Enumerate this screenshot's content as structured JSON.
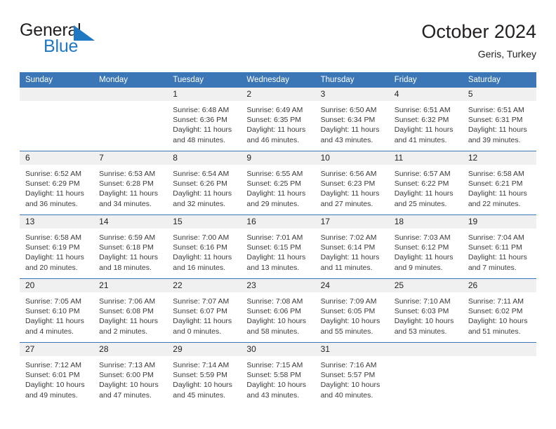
{
  "brand": {
    "name_part1": "General",
    "name_part2": "Blue",
    "triangle_color": "#1f78c1",
    "icon": "triangle-icon"
  },
  "header": {
    "title": "October 2024",
    "subtitle": "Geris, Turkey"
  },
  "colors": {
    "header_blue": "#3b77b7",
    "band_gray": "#f0f0f0",
    "text": "#231f20",
    "detail_text": "#3a3a3a",
    "brand_blue": "#1f78c1"
  },
  "weekdays": [
    "Sunday",
    "Monday",
    "Tuesday",
    "Wednesday",
    "Thursday",
    "Friday",
    "Saturday"
  ],
  "labels": {
    "sunrise": "Sunrise:",
    "sunset": "Sunset:",
    "daylight": "Daylight:"
  },
  "weeks": [
    [
      {
        "day": "",
        "empty": true
      },
      {
        "day": "",
        "empty": true
      },
      {
        "day": "1",
        "sunrise": "Sunrise: 6:48 AM",
        "sunset": "Sunset: 6:36 PM",
        "daylight1": "Daylight: 11 hours",
        "daylight2": "and 48 minutes."
      },
      {
        "day": "2",
        "sunrise": "Sunrise: 6:49 AM",
        "sunset": "Sunset: 6:35 PM",
        "daylight1": "Daylight: 11 hours",
        "daylight2": "and 46 minutes."
      },
      {
        "day": "3",
        "sunrise": "Sunrise: 6:50 AM",
        "sunset": "Sunset: 6:34 PM",
        "daylight1": "Daylight: 11 hours",
        "daylight2": "and 43 minutes."
      },
      {
        "day": "4",
        "sunrise": "Sunrise: 6:51 AM",
        "sunset": "Sunset: 6:32 PM",
        "daylight1": "Daylight: 11 hours",
        "daylight2": "and 41 minutes."
      },
      {
        "day": "5",
        "sunrise": "Sunrise: 6:51 AM",
        "sunset": "Sunset: 6:31 PM",
        "daylight1": "Daylight: 11 hours",
        "daylight2": "and 39 minutes."
      }
    ],
    [
      {
        "day": "6",
        "sunrise": "Sunrise: 6:52 AM",
        "sunset": "Sunset: 6:29 PM",
        "daylight1": "Daylight: 11 hours",
        "daylight2": "and 36 minutes."
      },
      {
        "day": "7",
        "sunrise": "Sunrise: 6:53 AM",
        "sunset": "Sunset: 6:28 PM",
        "daylight1": "Daylight: 11 hours",
        "daylight2": "and 34 minutes."
      },
      {
        "day": "8",
        "sunrise": "Sunrise: 6:54 AM",
        "sunset": "Sunset: 6:26 PM",
        "daylight1": "Daylight: 11 hours",
        "daylight2": "and 32 minutes."
      },
      {
        "day": "9",
        "sunrise": "Sunrise: 6:55 AM",
        "sunset": "Sunset: 6:25 PM",
        "daylight1": "Daylight: 11 hours",
        "daylight2": "and 29 minutes."
      },
      {
        "day": "10",
        "sunrise": "Sunrise: 6:56 AM",
        "sunset": "Sunset: 6:23 PM",
        "daylight1": "Daylight: 11 hours",
        "daylight2": "and 27 minutes."
      },
      {
        "day": "11",
        "sunrise": "Sunrise: 6:57 AM",
        "sunset": "Sunset: 6:22 PM",
        "daylight1": "Daylight: 11 hours",
        "daylight2": "and 25 minutes."
      },
      {
        "day": "12",
        "sunrise": "Sunrise: 6:58 AM",
        "sunset": "Sunset: 6:21 PM",
        "daylight1": "Daylight: 11 hours",
        "daylight2": "and 22 minutes."
      }
    ],
    [
      {
        "day": "13",
        "sunrise": "Sunrise: 6:58 AM",
        "sunset": "Sunset: 6:19 PM",
        "daylight1": "Daylight: 11 hours",
        "daylight2": "and 20 minutes."
      },
      {
        "day": "14",
        "sunrise": "Sunrise: 6:59 AM",
        "sunset": "Sunset: 6:18 PM",
        "daylight1": "Daylight: 11 hours",
        "daylight2": "and 18 minutes."
      },
      {
        "day": "15",
        "sunrise": "Sunrise: 7:00 AM",
        "sunset": "Sunset: 6:16 PM",
        "daylight1": "Daylight: 11 hours",
        "daylight2": "and 16 minutes."
      },
      {
        "day": "16",
        "sunrise": "Sunrise: 7:01 AM",
        "sunset": "Sunset: 6:15 PM",
        "daylight1": "Daylight: 11 hours",
        "daylight2": "and 13 minutes."
      },
      {
        "day": "17",
        "sunrise": "Sunrise: 7:02 AM",
        "sunset": "Sunset: 6:14 PM",
        "daylight1": "Daylight: 11 hours",
        "daylight2": "and 11 minutes."
      },
      {
        "day": "18",
        "sunrise": "Sunrise: 7:03 AM",
        "sunset": "Sunset: 6:12 PM",
        "daylight1": "Daylight: 11 hours",
        "daylight2": "and 9 minutes."
      },
      {
        "day": "19",
        "sunrise": "Sunrise: 7:04 AM",
        "sunset": "Sunset: 6:11 PM",
        "daylight1": "Daylight: 11 hours",
        "daylight2": "and 7 minutes."
      }
    ],
    [
      {
        "day": "20",
        "sunrise": "Sunrise: 7:05 AM",
        "sunset": "Sunset: 6:10 PM",
        "daylight1": "Daylight: 11 hours",
        "daylight2": "and 4 minutes."
      },
      {
        "day": "21",
        "sunrise": "Sunrise: 7:06 AM",
        "sunset": "Sunset: 6:08 PM",
        "daylight1": "Daylight: 11 hours",
        "daylight2": "and 2 minutes."
      },
      {
        "day": "22",
        "sunrise": "Sunrise: 7:07 AM",
        "sunset": "Sunset: 6:07 PM",
        "daylight1": "Daylight: 11 hours",
        "daylight2": "and 0 minutes."
      },
      {
        "day": "23",
        "sunrise": "Sunrise: 7:08 AM",
        "sunset": "Sunset: 6:06 PM",
        "daylight1": "Daylight: 10 hours",
        "daylight2": "and 58 minutes."
      },
      {
        "day": "24",
        "sunrise": "Sunrise: 7:09 AM",
        "sunset": "Sunset: 6:05 PM",
        "daylight1": "Daylight: 10 hours",
        "daylight2": "and 55 minutes."
      },
      {
        "day": "25",
        "sunrise": "Sunrise: 7:10 AM",
        "sunset": "Sunset: 6:03 PM",
        "daylight1": "Daylight: 10 hours",
        "daylight2": "and 53 minutes."
      },
      {
        "day": "26",
        "sunrise": "Sunrise: 7:11 AM",
        "sunset": "Sunset: 6:02 PM",
        "daylight1": "Daylight: 10 hours",
        "daylight2": "and 51 minutes."
      }
    ],
    [
      {
        "day": "27",
        "sunrise": "Sunrise: 7:12 AM",
        "sunset": "Sunset: 6:01 PM",
        "daylight1": "Daylight: 10 hours",
        "daylight2": "and 49 minutes."
      },
      {
        "day": "28",
        "sunrise": "Sunrise: 7:13 AM",
        "sunset": "Sunset: 6:00 PM",
        "daylight1": "Daylight: 10 hours",
        "daylight2": "and 47 minutes."
      },
      {
        "day": "29",
        "sunrise": "Sunrise: 7:14 AM",
        "sunset": "Sunset: 5:59 PM",
        "daylight1": "Daylight: 10 hours",
        "daylight2": "and 45 minutes."
      },
      {
        "day": "30",
        "sunrise": "Sunrise: 7:15 AM",
        "sunset": "Sunset: 5:58 PM",
        "daylight1": "Daylight: 10 hours",
        "daylight2": "and 43 minutes."
      },
      {
        "day": "31",
        "sunrise": "Sunrise: 7:16 AM",
        "sunset": "Sunset: 5:57 PM",
        "daylight1": "Daylight: 10 hours",
        "daylight2": "and 40 minutes."
      },
      {
        "day": "",
        "empty": true
      },
      {
        "day": "",
        "empty": true
      }
    ]
  ]
}
